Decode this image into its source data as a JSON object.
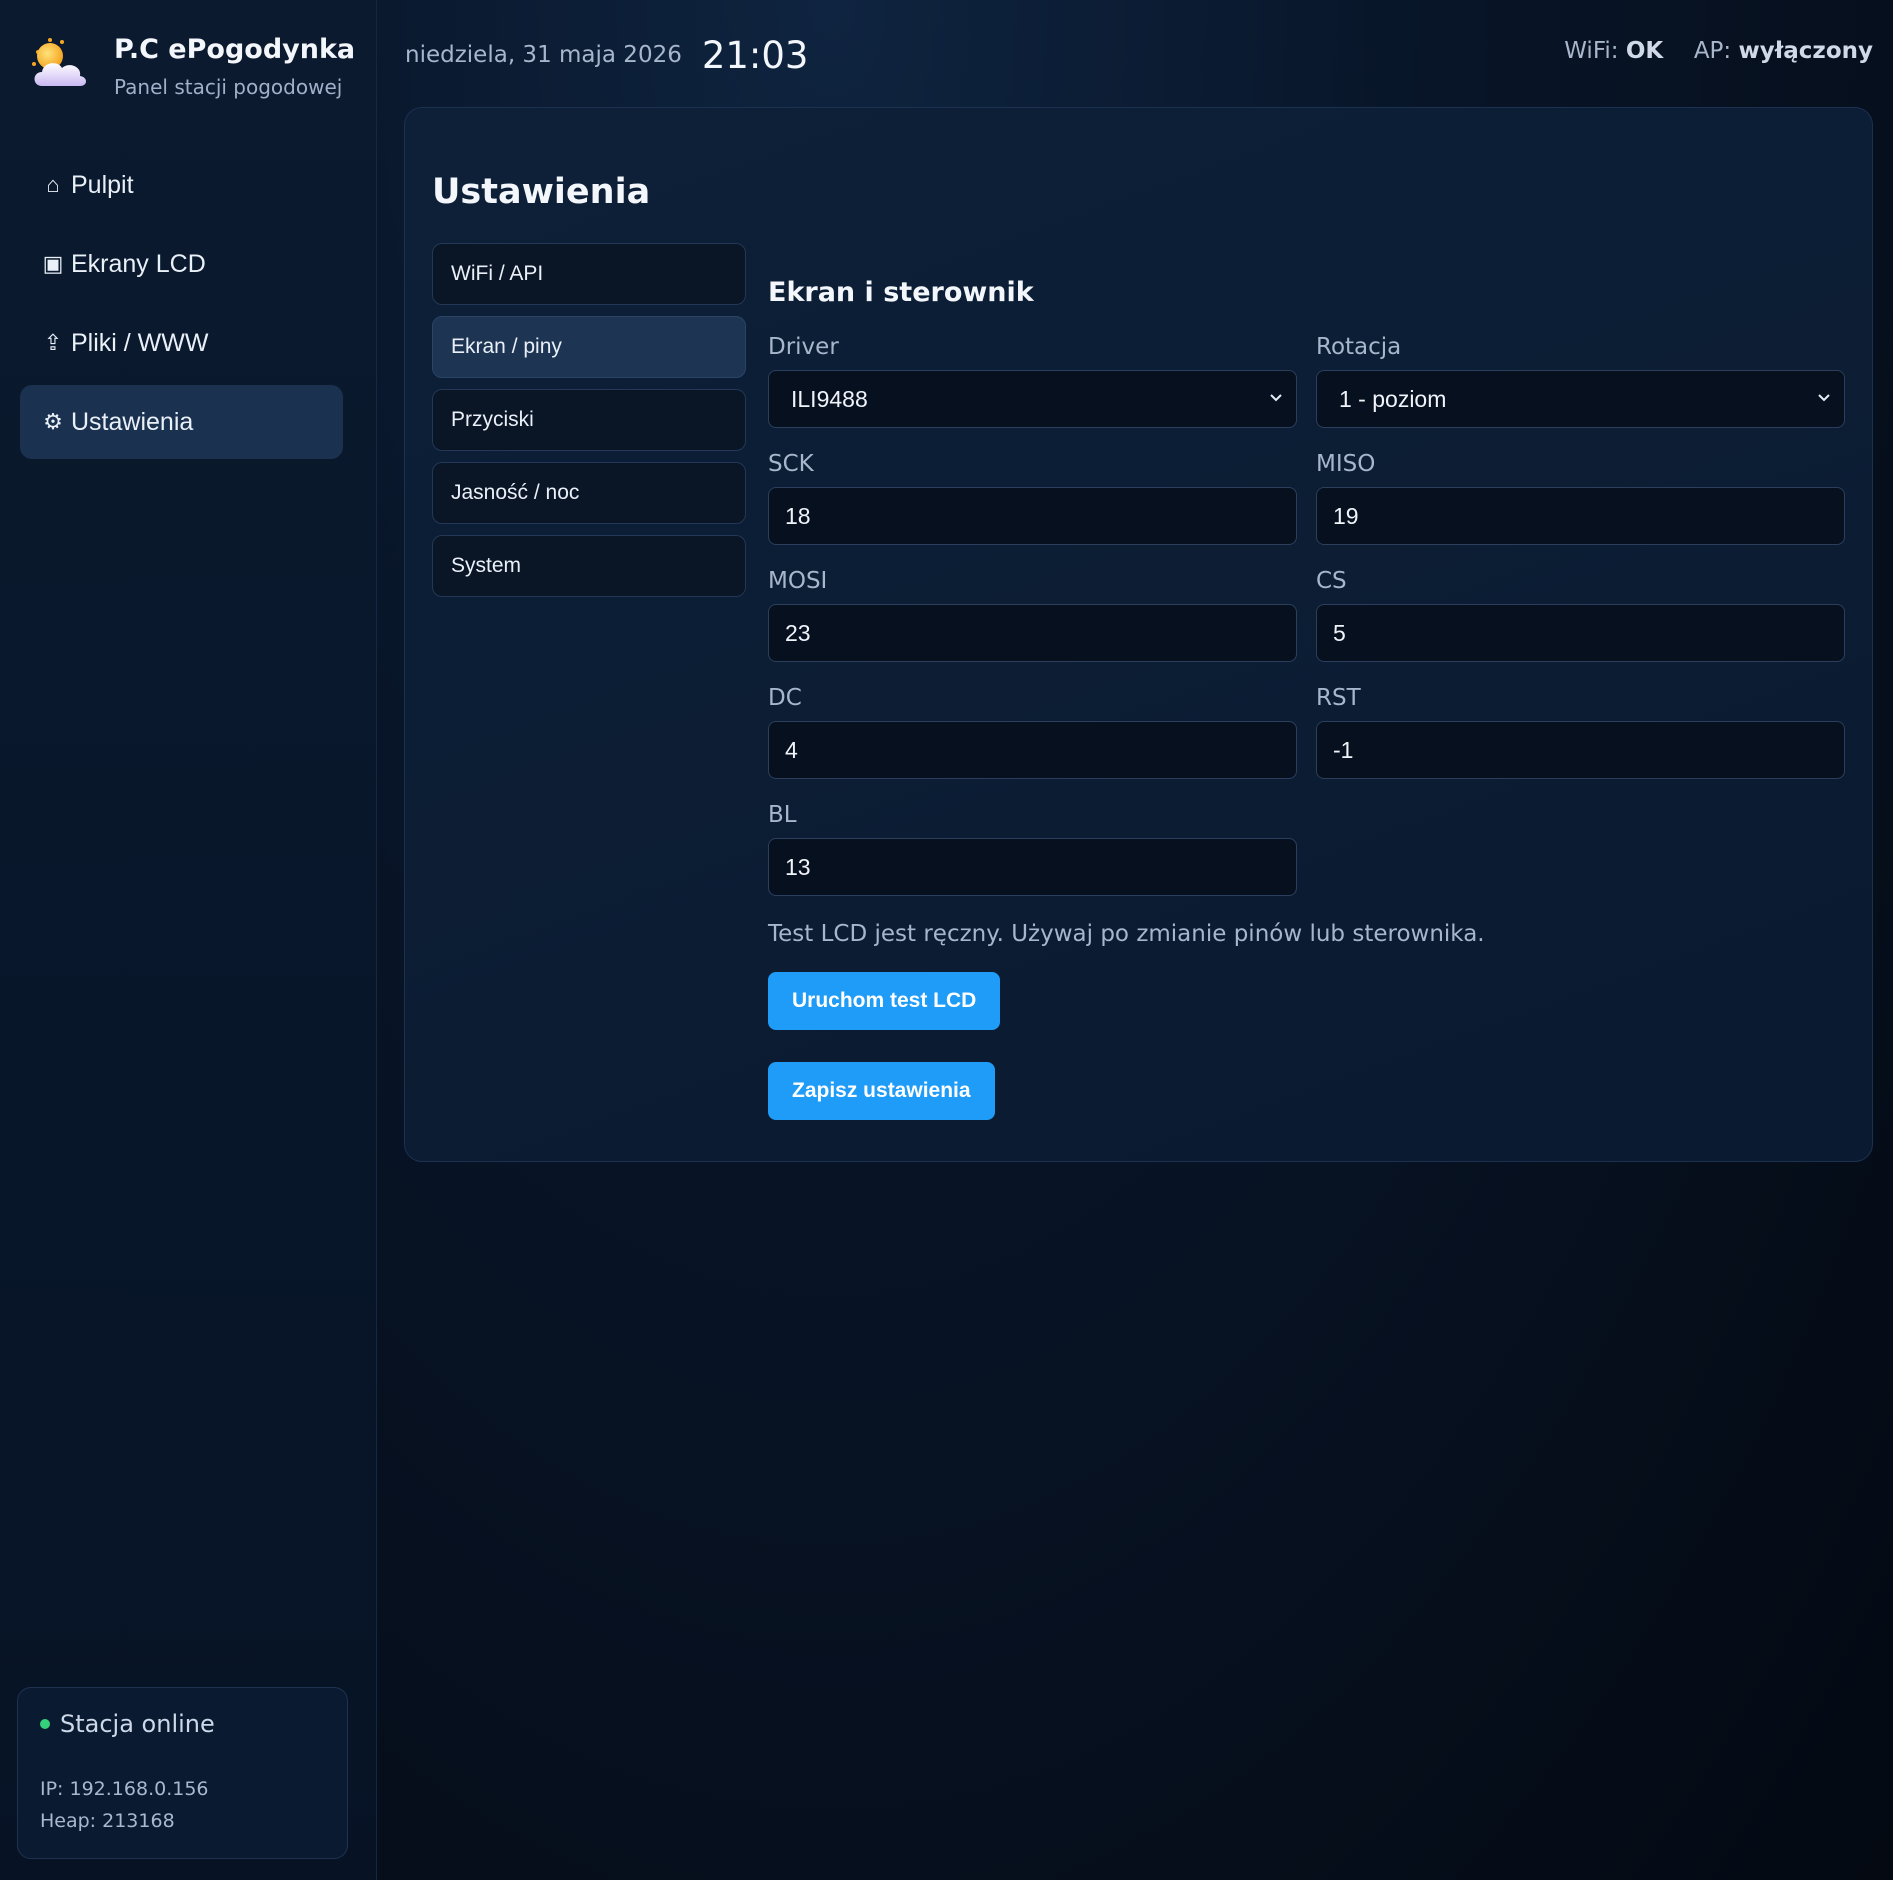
{
  "brand": {
    "title": "P.C ePogodynka",
    "subtitle": "Panel stacji pogodowej",
    "logo_icon": "sun-cloud-icon"
  },
  "nav": {
    "items": [
      {
        "icon": "⌂",
        "label": "Pulpit",
        "active": false
      },
      {
        "icon": "▣",
        "label": "Ekrany LCD",
        "active": false
      },
      {
        "icon": "⇪",
        "label": "Pliki / WWW",
        "active": false
      },
      {
        "icon": "⚙",
        "label": "Ustawienia",
        "active": true
      }
    ]
  },
  "status": {
    "online_label": "Stacja online",
    "ip": "IP: 192.168.0.156",
    "heap": "Heap: 213168",
    "dot_color": "#35d07a"
  },
  "topbar": {
    "date": "niedziela, 31 maja 2026",
    "time": "21:03",
    "wifi_label": "WiFi:",
    "wifi_value": "OK",
    "ap_label": "AP:",
    "ap_value": "wyłączony"
  },
  "settings": {
    "title": "Ustawienia",
    "tabs": [
      {
        "label": "WiFi / API",
        "active": false
      },
      {
        "label": "Ekran / piny",
        "active": true
      },
      {
        "label": "Przyciski",
        "active": false
      },
      {
        "label": "Jasność / noc",
        "active": false
      },
      {
        "label": "System",
        "active": false
      }
    ],
    "panel_title": "Ekran i sterownik",
    "fields": {
      "driver": {
        "label": "Driver",
        "value": "ILI9488"
      },
      "rotation": {
        "label": "Rotacja",
        "value": "1 - poziom"
      },
      "sck": {
        "label": "SCK",
        "value": "18"
      },
      "miso": {
        "label": "MISO",
        "value": "19"
      },
      "mosi": {
        "label": "MOSI",
        "value": "23"
      },
      "cs": {
        "label": "CS",
        "value": "5"
      },
      "dc": {
        "label": "DC",
        "value": "4"
      },
      "rst": {
        "label": "RST",
        "value": "-1"
      },
      "bl": {
        "label": "BL",
        "value": "13"
      }
    },
    "hint": "Test LCD jest ręczny. Używaj po zmianie pinów lub sterownika.",
    "test_button": "Uruchom test LCD",
    "save_button": "Zapisz ustawienia"
  },
  "colors": {
    "accent": "#1f9cf7",
    "active_nav": "#1b3150"
  }
}
